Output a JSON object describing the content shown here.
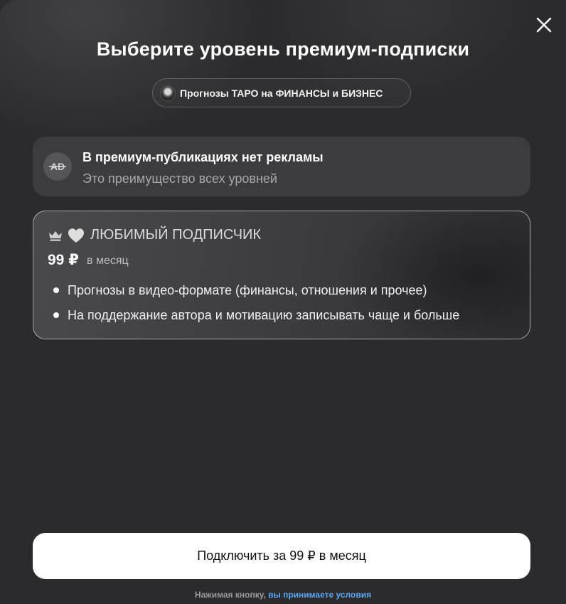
{
  "modal": {
    "title": "Выберите уровень премиум-подписки",
    "close_icon": "close-icon"
  },
  "author": {
    "name": "Прогнозы ТАРО на ФИНАНСЫ и БИЗНЕС",
    "avatar_icon": "avatar"
  },
  "no_ads": {
    "icon_text": "AD",
    "title": "В премиум-публикациях нет рекламы",
    "subtitle": "Это преимущество всех уровней"
  },
  "tier": {
    "icons": [
      "crown-icon",
      "heart-icon"
    ],
    "name": "ЛЮБИМЫЙ ПОДПИСЧИК",
    "price": "99 ₽",
    "period": "в месяц",
    "benefits": [
      "Прогнозы в видео-формате (финансы, отношения и прочее)",
      "На поддержание автора и мотивацию записывать чаще и больше"
    ]
  },
  "subscribe_button": {
    "label": "Подключить за 99 ₽ в месяц"
  },
  "terms": {
    "prefix": "Нажимая кнопку, ",
    "link_text": "вы принимаете условия"
  },
  "colors": {
    "background": "#2b2b2d",
    "card": "#3c3c3f",
    "link": "#5aa7f5",
    "button": "#ffffff"
  }
}
